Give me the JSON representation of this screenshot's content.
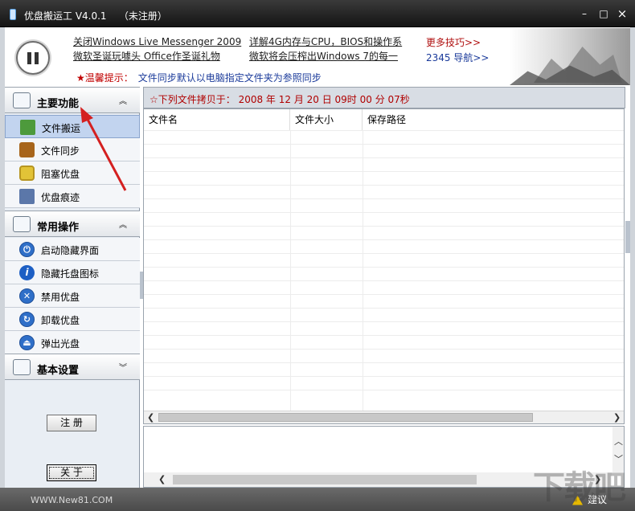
{
  "window": {
    "title": "优盘搬运工 V4.0.1    （未注册）",
    "min_glyph": "–",
    "max_glyph": "□",
    "close_glyph": "×"
  },
  "banner": {
    "news": [
      "关闭Windows Live Messenger 2009",
      "详解4G内存与CPU，BIOS和操作系",
      "微软圣诞玩噱头 Office作圣诞礼物",
      "微软将会压榨出Windows 7的每一"
    ],
    "more_tips": "更多技巧>>",
    "nav_2345": "2345 导航>>",
    "tip_label": "★温馨提示：",
    "tip_text": "文件同步默认以电脑指定文件夹为参照同步"
  },
  "sidebar": {
    "groups": [
      {
        "label": "主要功能",
        "chevron": "︽"
      },
      {
        "label": "常用操作",
        "chevron": "︽"
      },
      {
        "label": "基本设置",
        "chevron": "︾"
      }
    ],
    "main_items": [
      {
        "label": "文件搬运",
        "icon": "cart-icon"
      },
      {
        "label": "文件同步",
        "icon": "briefcase-icon"
      },
      {
        "label": "阻塞优盘",
        "icon": "lock-icon"
      },
      {
        "label": "优盘痕迹",
        "icon": "broom-icon"
      }
    ],
    "common_items": [
      {
        "label": "启动隐藏界面",
        "icon": "power-icon",
        "glyph": "⏻"
      },
      {
        "label": "隐藏托盘图标",
        "icon": "info-icon",
        "glyph": "i"
      },
      {
        "label": "禁用优盘",
        "icon": "close-icon",
        "glyph": "✕"
      },
      {
        "label": "卸载优盘",
        "icon": "refresh-icon",
        "glyph": "↻"
      },
      {
        "label": "弹出光盘",
        "icon": "eject-icon",
        "glyph": "⏏"
      }
    ],
    "register_label": "注  册",
    "about_label": "关  于"
  },
  "main": {
    "copy_header": "☆下列文件拷贝于：  2008 年 12 月 20 日 09时 00 分 07秒",
    "columns": [
      "文件名",
      "文件大小",
      "保存路径"
    ]
  },
  "statusbar": {
    "left_text": "WWW.New81.COM",
    "suggest_label": "建议"
  },
  "watermark": "下载吧",
  "colors": {
    "accent_red": "#b00000",
    "tip_blue": "#1a3a9a",
    "selected_bg": "#c2d4ef"
  }
}
